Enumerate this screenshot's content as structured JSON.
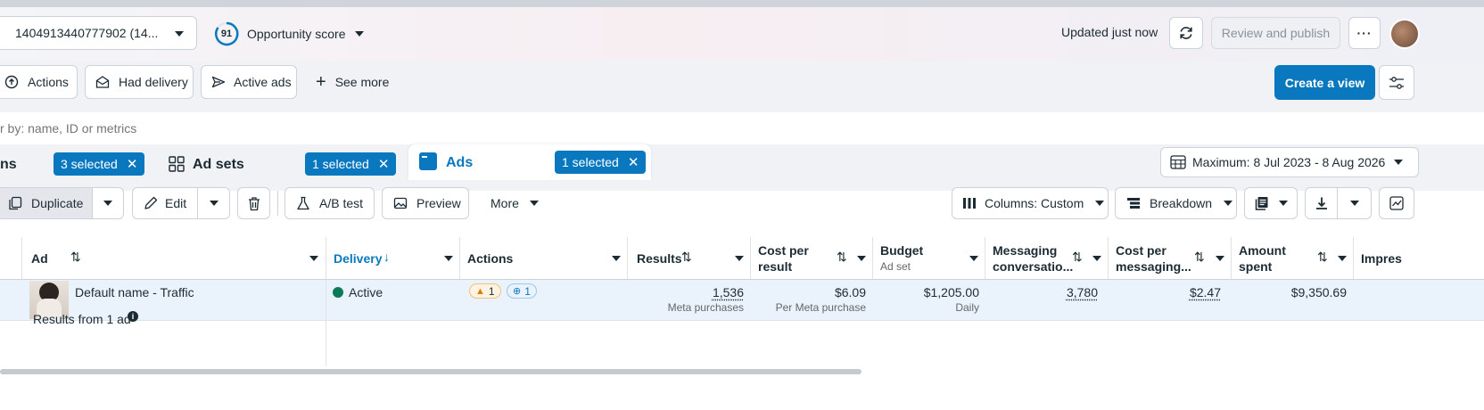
{
  "topbar": {
    "account_label": "1404913440777902 (14...",
    "score_value": "91",
    "score_label": "Opportunity score",
    "updated_text": "Updated just now",
    "review_publish_label": "Review and publish"
  },
  "filters": {
    "items": [
      {
        "label": "Actions",
        "icon": "actions-icon"
      },
      {
        "label": "Had delivery",
        "icon": "envelope-icon"
      },
      {
        "label": "Active ads",
        "icon": "send-icon"
      }
    ],
    "see_more_label": "See more",
    "create_view_label": "Create a view"
  },
  "search": {
    "placeholder": "r by: name, ID or metrics"
  },
  "tabs": {
    "campaigns_partial": "ns",
    "campaigns_selected": "3 selected",
    "adsets_label": "Ad sets",
    "adsets_selected": "1 selected",
    "ads_label": "Ads",
    "ads_selected": "1 selected",
    "date_range": "Maximum: 8 Jul 2023 - 8 Aug 2026"
  },
  "toolbar": {
    "duplicate_label": "Duplicate",
    "edit_label": "Edit",
    "ab_test_label": "A/B test",
    "preview_label": "Preview",
    "more_label": "More",
    "columns_label": "Columns: Custom",
    "breakdown_label": "Breakdown"
  },
  "table": {
    "headers": {
      "ad": "Ad",
      "delivery": "Delivery",
      "actions": "Actions",
      "results": "Results",
      "cost_per_result_l1": "Cost per",
      "cost_per_result_l2": "result",
      "budget": "Budget",
      "budget_sub": "Ad set",
      "messaging_l1": "Messaging",
      "messaging_l2": "conversatio...",
      "cost_messaging_l1": "Cost per",
      "cost_messaging_l2": "messaging...",
      "amount_l1": "Amount",
      "amount_l2": "spent",
      "impressions_partial": "Impres"
    },
    "row": {
      "ad_name": "Default name - Traffic",
      "delivery": "Active",
      "warning_count": "1",
      "action_count": "1",
      "results": "1,536",
      "results_sub": "Meta purchases",
      "cost_per_result": "$6.09",
      "cost_per_result_sub": "Per Meta purchase",
      "budget": "$1,205.00",
      "budget_sub": "Daily",
      "messaging": "3,780",
      "cost_messaging": "$2.47",
      "amount_spent": "$9,350.69"
    },
    "summary": "Results from 1 ad"
  },
  "colors": {
    "accent": "#0a78be",
    "active_dot": "#0b7a57",
    "warning": "#e07b00"
  }
}
